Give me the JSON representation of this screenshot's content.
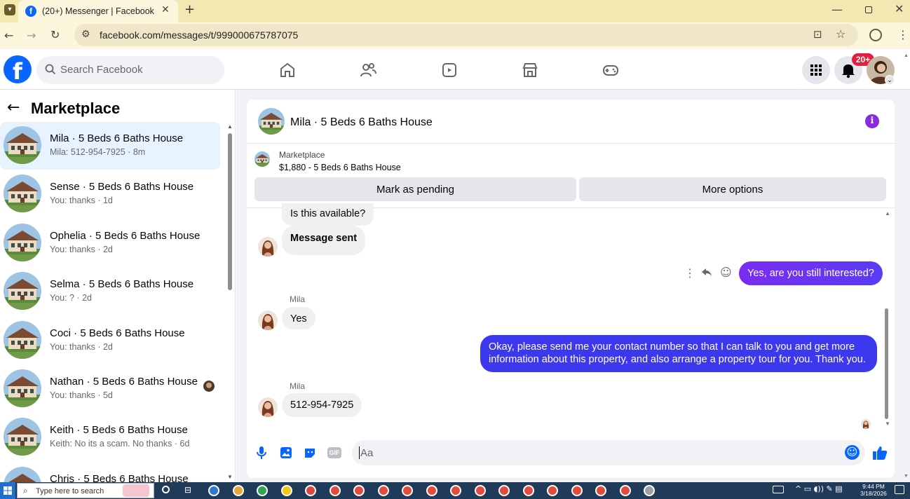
{
  "browser": {
    "tab_title": "(20+) Messenger | Facebook",
    "new_tab": "+",
    "url": "facebook.com/messages/t/999000675787075",
    "window_controls": [
      "minimize-icon",
      "restore-icon",
      "close-icon"
    ]
  },
  "header": {
    "search_placeholder": "Search Facebook",
    "notification_badge": "20+",
    "nav": [
      "home-icon",
      "friends-icon",
      "video-icon",
      "marketplace-icon",
      "gaming-icon"
    ]
  },
  "sidebar": {
    "title": "Marketplace",
    "conversations": [
      {
        "name": "Mila · 5 Beds 6 Baths House",
        "preview": "Mila: 512-954-7925 · 8m",
        "selected": true
      },
      {
        "name": "Sense · 5 Beds 6 Baths House",
        "preview": "You: thanks · 1d"
      },
      {
        "name": "Ophelia · 5 Beds 6 Baths House",
        "preview": "You: thanks · 2d"
      },
      {
        "name": "Selma · 5 Beds 6 Baths House",
        "preview": "You: ? · 2d"
      },
      {
        "name": "Coci · 5 Beds 6 Baths House",
        "preview": "You: thanks · 2d"
      },
      {
        "name": "Nathan · 5 Beds 6 Baths House",
        "preview": "You: thanks · 5d"
      },
      {
        "name": "Keith · 5 Beds 6 Baths House",
        "preview": "Keith: No its a scam. No thanks · 6d"
      },
      {
        "name": "Chris · 5 Beds 6 Baths House",
        "preview": ""
      }
    ]
  },
  "chat": {
    "title": "Mila · 5 Beds 6 Baths House",
    "listing_label": "Marketplace",
    "listing_price": "$1,880 - 5 Beds 6 Baths House",
    "mark_pending": "Mark as pending",
    "more_options": "More options",
    "messages": {
      "m1": "Is this available?",
      "m2": "Message sent",
      "m3": "Yes, are you still interested?",
      "sender1": "Mila",
      "m4": "Yes",
      "m5_line1": "Okay, please send me your contact number so that I can talk to you and get more",
      "m5_line2": "information about this property, and also arrange a property tour for you. Thank you.",
      "sender2": "Mila",
      "m6": "512-954-7925"
    },
    "composer_placeholder": "Aa"
  },
  "taskbar": {
    "search_placeholder": "Type here to search",
    "time": "9:44 PM",
    "date": "3/18/2026"
  },
  "colors": {
    "accent": "#0866ff",
    "outgoing": "#5a3cf5",
    "purple_info": "#8a2be2",
    "badge": "#e41e3f"
  }
}
